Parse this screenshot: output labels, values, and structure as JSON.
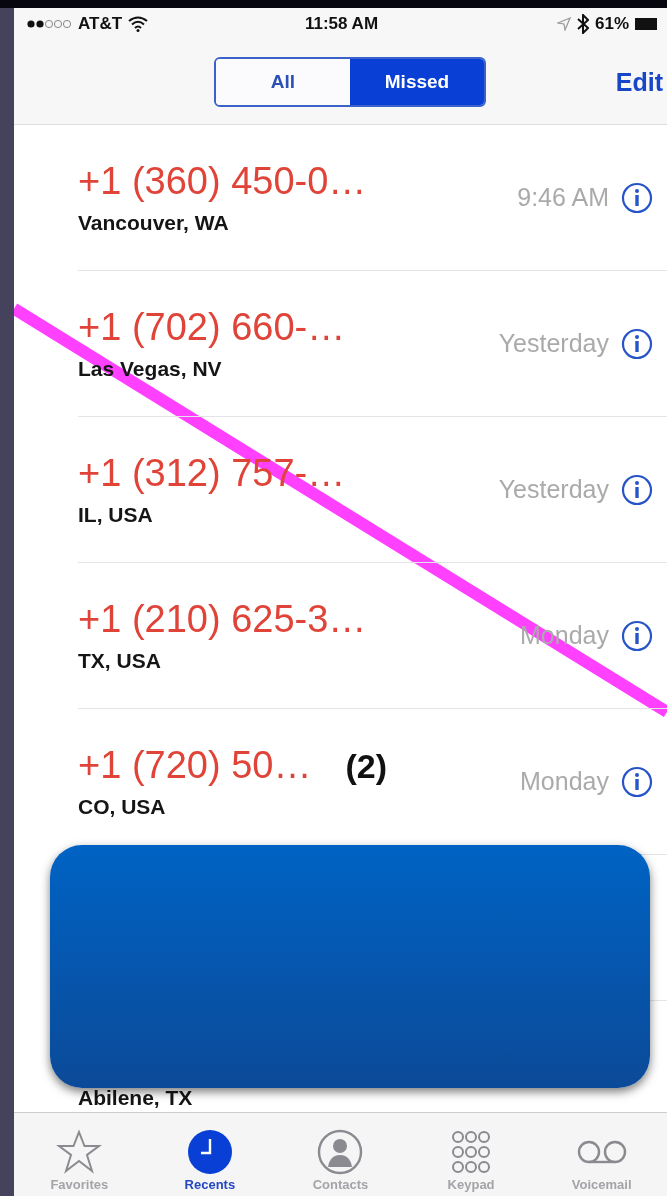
{
  "status_bar": {
    "carrier": "AT&T",
    "time": "11:58 AM",
    "battery": "61%"
  },
  "segments": [
    {
      "label": "All",
      "selected": false
    },
    {
      "label": "Missed",
      "selected": true
    }
  ],
  "edit": "Edit",
  "calls": [
    {
      "number": "+1 (360) 450-0…",
      "location": "Vancouver, WA",
      "time": "9:46 AM"
    },
    {
      "number": "+1 (702) 660-…",
      "location": "Las Vegas, NV",
      "time": "Yesterday"
    },
    {
      "number": "+1 (312) 757-…",
      "location": "IL, USA",
      "time": "Yesterday"
    },
    {
      "number": "+1 (210) 625-3…",
      "location": "TX, USA",
      "time": "Monday"
    },
    {
      "number": "+1 (720) 50…",
      "count": "(2)",
      "location": "CO, USA",
      "time": "Monday"
    }
  ],
  "covered_row": {
    "location": "Abilene, TX"
  },
  "tabs": [
    {
      "label": "Favorites",
      "kind": "star",
      "selected": false
    },
    {
      "label": "Recents",
      "kind": "clock",
      "selected": true
    },
    {
      "label": "Contacts",
      "kind": "person",
      "selected": false
    },
    {
      "label": "Keypad",
      "kind": "keypad",
      "selected": false
    },
    {
      "label": "Voicemail",
      "kind": "voicemail",
      "selected": false
    }
  ]
}
